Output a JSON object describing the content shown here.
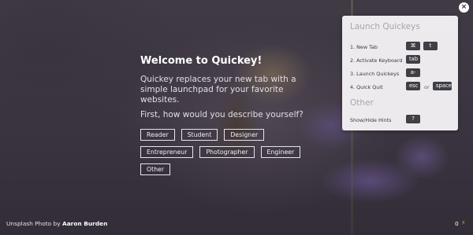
{
  "welcome": {
    "title": "Welcome to Quickey!",
    "description": "Quickey replaces your new tab with a simple launchpad for your favorite websites.",
    "question": "First, how would you describe yourself?",
    "options": [
      "Reader",
      "Student",
      "Designer",
      "Entrepreneur",
      "Photographer",
      "Engineer",
      "Other"
    ]
  },
  "panel": {
    "launch_title": "Launch Quickeys",
    "shortcuts": [
      {
        "label": "1. New Tab",
        "keys": [
          "⌘",
          "t"
        ]
      },
      {
        "label": "2. Activate Keyboard",
        "keys": [
          "tab"
        ]
      },
      {
        "label": "3. Launch Quickeys",
        "keys": [
          "a-z"
        ]
      },
      {
        "label": "4. Quick Quit",
        "keys": [
          "esc",
          "space"
        ],
        "separator": "or"
      }
    ],
    "other_title": "Other",
    "other": [
      {
        "label": "Show/Hide Hints",
        "keys": [
          "?"
        ]
      }
    ]
  },
  "close_label": "×",
  "credit": {
    "prefix": "Unsplash Photo by",
    "author": "Aaron Burden"
  },
  "status": {
    "count": "0",
    "icon": "lightning-bolt-icon",
    "icon_glyph": "⚡",
    "accent": "#e8a43a"
  }
}
